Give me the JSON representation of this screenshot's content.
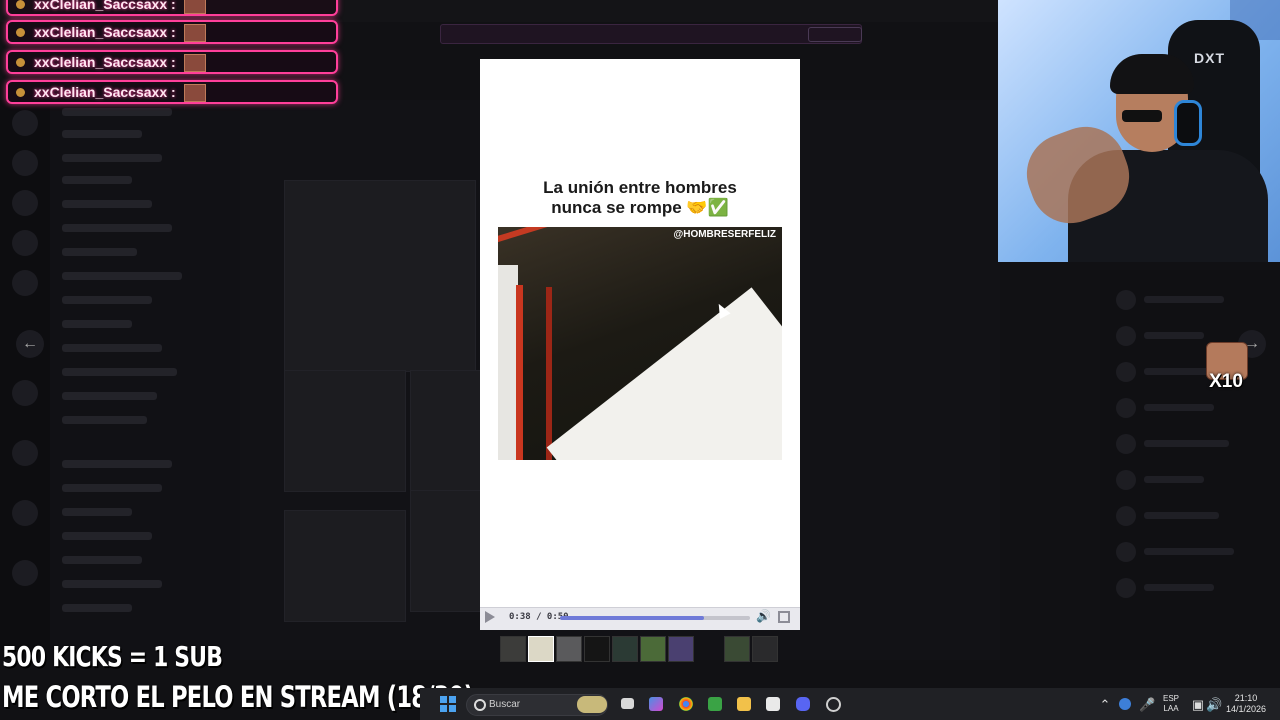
{
  "overlay_chat": {
    "messages": [
      {
        "username": "xxClelian_Saccsaxx :"
      },
      {
        "username": "xxClelian_Saccsaxx :"
      },
      {
        "username": "xxClelian_Saccsaxx :"
      },
      {
        "username": "xxClelian_Saccsaxx :"
      }
    ]
  },
  "modal": {
    "caption_line1": "La unión entre hombres",
    "caption_line2": "nunca se rompe 🤝✅",
    "watermark": "@HOMBRESERFELIZ",
    "player": {
      "time": "0:38 / 0:50",
      "progress": 0.76
    }
  },
  "webcam": {
    "chair_logo": "DXT"
  },
  "sub_badge": {
    "label": "X10"
  },
  "stream_overlay": {
    "line1": "500 KICKS = 1 SUB",
    "line2": "ME CORTO EL PELO EN STREAM (18/30)"
  },
  "taskbar": {
    "search_label": "Buscar",
    "lang_line1": "ESP",
    "lang_line2": "LAA",
    "time": "21:10",
    "date": "14/1/2026"
  },
  "icons": [
    "play-icon",
    "volume-icon",
    "fullscreen-icon",
    "windows-icon",
    "search-icon",
    "chevron-left-icon",
    "chevron-right-icon"
  ],
  "colors": {
    "chat_border": "#ff3f9a",
    "progress_fill": "#6f7ad8",
    "modal_bg": "#ffffff"
  }
}
